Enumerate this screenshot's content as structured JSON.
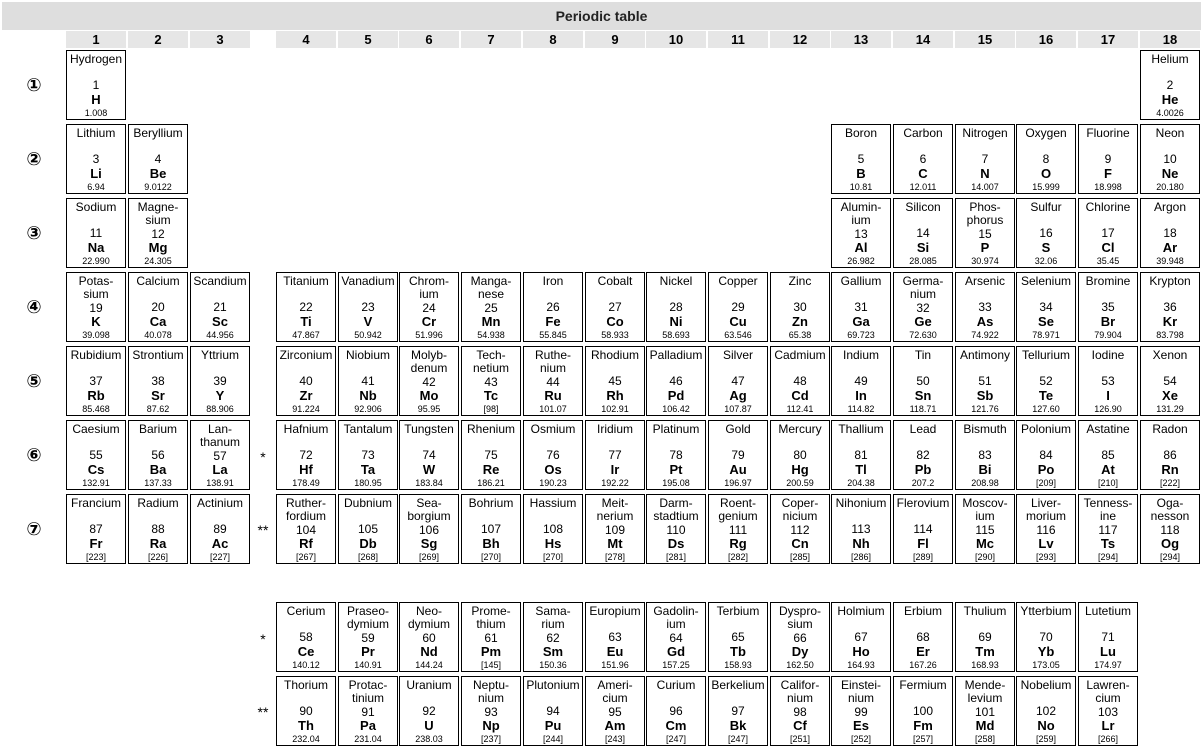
{
  "title": "Periodic table",
  "groups": [
    "1",
    "2",
    "3",
    "4",
    "5",
    "6",
    "7",
    "8",
    "9",
    "10",
    "11",
    "12",
    "13",
    "14",
    "15",
    "16",
    "17",
    "18"
  ],
  "periods": [
    "①",
    "②",
    "③",
    "④",
    "⑤",
    "⑥",
    "⑦"
  ],
  "markers": {
    "lanthanide": "*",
    "actinide": "**"
  },
  "elements": [
    {
      "name": "Hydrogen",
      "z": "1",
      "sym": "H",
      "mass": "1.008",
      "g": 1,
      "p": 1
    },
    {
      "name": "Helium",
      "z": "2",
      "sym": "He",
      "mass": "4.0026",
      "g": 18,
      "p": 1
    },
    {
      "name": "Lithium",
      "z": "3",
      "sym": "Li",
      "mass": "6.94",
      "g": 1,
      "p": 2
    },
    {
      "name": "Beryllium",
      "z": "4",
      "sym": "Be",
      "mass": "9.0122",
      "g": 2,
      "p": 2
    },
    {
      "name": "Boron",
      "z": "5",
      "sym": "B",
      "mass": "10.81",
      "g": 13,
      "p": 2
    },
    {
      "name": "Carbon",
      "z": "6",
      "sym": "C",
      "mass": "12.011",
      "g": 14,
      "p": 2
    },
    {
      "name": "Nitrogen",
      "z": "7",
      "sym": "N",
      "mass": "14.007",
      "g": 15,
      "p": 2
    },
    {
      "name": "Oxygen",
      "z": "8",
      "sym": "O",
      "mass": "15.999",
      "g": 16,
      "p": 2
    },
    {
      "name": "Fluorine",
      "z": "9",
      "sym": "F",
      "mass": "18.998",
      "g": 17,
      "p": 2
    },
    {
      "name": "Neon",
      "z": "10",
      "sym": "Ne",
      "mass": "20.180",
      "g": 18,
      "p": 2
    },
    {
      "name": "Sodium",
      "z": "11",
      "sym": "Na",
      "mass": "22.990",
      "g": 1,
      "p": 3
    },
    {
      "name": "Magne-\nsium",
      "z": "12",
      "sym": "Mg",
      "mass": "24.305",
      "g": 2,
      "p": 3
    },
    {
      "name": "Alumin-\nium",
      "z": "13",
      "sym": "Al",
      "mass": "26.982",
      "g": 13,
      "p": 3
    },
    {
      "name": "Silicon",
      "z": "14",
      "sym": "Si",
      "mass": "28.085",
      "g": 14,
      "p": 3
    },
    {
      "name": "Phos-\nphorus",
      "z": "15",
      "sym": "P",
      "mass": "30.974",
      "g": 15,
      "p": 3
    },
    {
      "name": "Sulfur",
      "z": "16",
      "sym": "S",
      "mass": "32.06",
      "g": 16,
      "p": 3
    },
    {
      "name": "Chlorine",
      "z": "17",
      "sym": "Cl",
      "mass": "35.45",
      "g": 17,
      "p": 3
    },
    {
      "name": "Argon",
      "z": "18",
      "sym": "Ar",
      "mass": "39.948",
      "g": 18,
      "p": 3
    },
    {
      "name": "Potas-\nsium",
      "z": "19",
      "sym": "K",
      "mass": "39.098",
      "g": 1,
      "p": 4
    },
    {
      "name": "Calcium",
      "z": "20",
      "sym": "Ca",
      "mass": "40.078",
      "g": 2,
      "p": 4
    },
    {
      "name": "Scandium",
      "z": "21",
      "sym": "Sc",
      "mass": "44.956",
      "g": 3,
      "p": 4
    },
    {
      "name": "Titanium",
      "z": "22",
      "sym": "Ti",
      "mass": "47.867",
      "g": 4,
      "p": 4
    },
    {
      "name": "Vanadium",
      "z": "23",
      "sym": "V",
      "mass": "50.942",
      "g": 5,
      "p": 4
    },
    {
      "name": "Chrom-\nium",
      "z": "24",
      "sym": "Cr",
      "mass": "51.996",
      "g": 6,
      "p": 4
    },
    {
      "name": "Manga-\nnese",
      "z": "25",
      "sym": "Mn",
      "mass": "54.938",
      "g": 7,
      "p": 4
    },
    {
      "name": "Iron",
      "z": "26",
      "sym": "Fe",
      "mass": "55.845",
      "g": 8,
      "p": 4
    },
    {
      "name": "Cobalt",
      "z": "27",
      "sym": "Co",
      "mass": "58.933",
      "g": 9,
      "p": 4
    },
    {
      "name": "Nickel",
      "z": "28",
      "sym": "Ni",
      "mass": "58.693",
      "g": 10,
      "p": 4
    },
    {
      "name": "Copper",
      "z": "29",
      "sym": "Cu",
      "mass": "63.546",
      "g": 11,
      "p": 4
    },
    {
      "name": "Zinc",
      "z": "30",
      "sym": "Zn",
      "mass": "65.38",
      "g": 12,
      "p": 4
    },
    {
      "name": "Gallium",
      "z": "31",
      "sym": "Ga",
      "mass": "69.723",
      "g": 13,
      "p": 4
    },
    {
      "name": "Germa-\nnium",
      "z": "32",
      "sym": "Ge",
      "mass": "72.630",
      "g": 14,
      "p": 4
    },
    {
      "name": "Arsenic",
      "z": "33",
      "sym": "As",
      "mass": "74.922",
      "g": 15,
      "p": 4
    },
    {
      "name": "Selenium",
      "z": "34",
      "sym": "Se",
      "mass": "78.971",
      "g": 16,
      "p": 4
    },
    {
      "name": "Bromine",
      "z": "35",
      "sym": "Br",
      "mass": "79.904",
      "g": 17,
      "p": 4
    },
    {
      "name": "Krypton",
      "z": "36",
      "sym": "Kr",
      "mass": "83.798",
      "g": 18,
      "p": 4
    },
    {
      "name": "Rubidium",
      "z": "37",
      "sym": "Rb",
      "mass": "85.468",
      "g": 1,
      "p": 5
    },
    {
      "name": "Strontium",
      "z": "38",
      "sym": "Sr",
      "mass": "87.62",
      "g": 2,
      "p": 5
    },
    {
      "name": "Yttrium",
      "z": "39",
      "sym": "Y",
      "mass": "88.906",
      "g": 3,
      "p": 5
    },
    {
      "name": "Zirconium",
      "z": "40",
      "sym": "Zr",
      "mass": "91.224",
      "g": 4,
      "p": 5
    },
    {
      "name": "Niobium",
      "z": "41",
      "sym": "Nb",
      "mass": "92.906",
      "g": 5,
      "p": 5
    },
    {
      "name": "Molyb-\ndenum",
      "z": "42",
      "sym": "Mo",
      "mass": "95.95",
      "g": 6,
      "p": 5
    },
    {
      "name": "Tech-\nnetium",
      "z": "43",
      "sym": "Tc",
      "mass": "[98]",
      "g": 7,
      "p": 5
    },
    {
      "name": "Ruthe-\nnium",
      "z": "44",
      "sym": "Ru",
      "mass": "101.07",
      "g": 8,
      "p": 5
    },
    {
      "name": "Rhodium",
      "z": "45",
      "sym": "Rh",
      "mass": "102.91",
      "g": 9,
      "p": 5
    },
    {
      "name": "Palladium",
      "z": "46",
      "sym": "Pd",
      "mass": "106.42",
      "g": 10,
      "p": 5
    },
    {
      "name": "Silver",
      "z": "47",
      "sym": "Ag",
      "mass": "107.87",
      "g": 11,
      "p": 5
    },
    {
      "name": "Cadmium",
      "z": "48",
      "sym": "Cd",
      "mass": "112.41",
      "g": 12,
      "p": 5
    },
    {
      "name": "Indium",
      "z": "49",
      "sym": "In",
      "mass": "114.82",
      "g": 13,
      "p": 5
    },
    {
      "name": "Tin",
      "z": "50",
      "sym": "Sn",
      "mass": "118.71",
      "g": 14,
      "p": 5
    },
    {
      "name": "Antimony",
      "z": "51",
      "sym": "Sb",
      "mass": "121.76",
      "g": 15,
      "p": 5
    },
    {
      "name": "Tellurium",
      "z": "52",
      "sym": "Te",
      "mass": "127.60",
      "g": 16,
      "p": 5
    },
    {
      "name": "Iodine",
      "z": "53",
      "sym": "I",
      "mass": "126.90",
      "g": 17,
      "p": 5
    },
    {
      "name": "Xenon",
      "z": "54",
      "sym": "Xe",
      "mass": "131.29",
      "g": 18,
      "p": 5
    },
    {
      "name": "Caesium",
      "z": "55",
      "sym": "Cs",
      "mass": "132.91",
      "g": 1,
      "p": 6
    },
    {
      "name": "Barium",
      "z": "56",
      "sym": "Ba",
      "mass": "137.33",
      "g": 2,
      "p": 6
    },
    {
      "name": "Lan-\nthanum",
      "z": "57",
      "sym": "La",
      "mass": "138.91",
      "g": 3,
      "p": 6
    },
    {
      "name": "Hafnium",
      "z": "72",
      "sym": "Hf",
      "mass": "178.49",
      "g": 4,
      "p": 6
    },
    {
      "name": "Tantalum",
      "z": "73",
      "sym": "Ta",
      "mass": "180.95",
      "g": 5,
      "p": 6
    },
    {
      "name": "Tungsten",
      "z": "74",
      "sym": "W",
      "mass": "183.84",
      "g": 6,
      "p": 6
    },
    {
      "name": "Rhenium",
      "z": "75",
      "sym": "Re",
      "mass": "186.21",
      "g": 7,
      "p": 6
    },
    {
      "name": "Osmium",
      "z": "76",
      "sym": "Os",
      "mass": "190.23",
      "g": 8,
      "p": 6
    },
    {
      "name": "Iridium",
      "z": "77",
      "sym": "Ir",
      "mass": "192.22",
      "g": 9,
      "p": 6
    },
    {
      "name": "Platinum",
      "z": "78",
      "sym": "Pt",
      "mass": "195.08",
      "g": 10,
      "p": 6
    },
    {
      "name": "Gold",
      "z": "79",
      "sym": "Au",
      "mass": "196.97",
      "g": 11,
      "p": 6
    },
    {
      "name": "Mercury",
      "z": "80",
      "sym": "Hg",
      "mass": "200.59",
      "g": 12,
      "p": 6
    },
    {
      "name": "Thallium",
      "z": "81",
      "sym": "Tl",
      "mass": "204.38",
      "g": 13,
      "p": 6
    },
    {
      "name": "Lead",
      "z": "82",
      "sym": "Pb",
      "mass": "207.2",
      "g": 14,
      "p": 6
    },
    {
      "name": "Bismuth",
      "z": "83",
      "sym": "Bi",
      "mass": "208.98",
      "g": 15,
      "p": 6
    },
    {
      "name": "Polonium",
      "z": "84",
      "sym": "Po",
      "mass": "[209]",
      "g": 16,
      "p": 6
    },
    {
      "name": "Astatine",
      "z": "85",
      "sym": "At",
      "mass": "[210]",
      "g": 17,
      "p": 6
    },
    {
      "name": "Radon",
      "z": "86",
      "sym": "Rn",
      "mass": "[222]",
      "g": 18,
      "p": 6
    },
    {
      "name": "Francium",
      "z": "87",
      "sym": "Fr",
      "mass": "[223]",
      "g": 1,
      "p": 7
    },
    {
      "name": "Radium",
      "z": "88",
      "sym": "Ra",
      "mass": "[226]",
      "g": 2,
      "p": 7
    },
    {
      "name": "Actinium",
      "z": "89",
      "sym": "Ac",
      "mass": "[227]",
      "g": 3,
      "p": 7
    },
    {
      "name": "Ruther-\nfordium",
      "z": "104",
      "sym": "Rf",
      "mass": "[267]",
      "g": 4,
      "p": 7
    },
    {
      "name": "Dubnium",
      "z": "105",
      "sym": "Db",
      "mass": "[268]",
      "g": 5,
      "p": 7
    },
    {
      "name": "Sea-\nborgium",
      "z": "106",
      "sym": "Sg",
      "mass": "[269]",
      "g": 6,
      "p": 7
    },
    {
      "name": "Bohrium",
      "z": "107",
      "sym": "Bh",
      "mass": "[270]",
      "g": 7,
      "p": 7
    },
    {
      "name": "Hassium",
      "z": "108",
      "sym": "Hs",
      "mass": "[270]",
      "g": 8,
      "p": 7
    },
    {
      "name": "Meit-\nnerium",
      "z": "109",
      "sym": "Mt",
      "mass": "[278]",
      "g": 9,
      "p": 7
    },
    {
      "name": "Darm-\nstadtium",
      "z": "110",
      "sym": "Ds",
      "mass": "[281]",
      "g": 10,
      "p": 7
    },
    {
      "name": "Roent-\ngenium",
      "z": "111",
      "sym": "Rg",
      "mass": "[282]",
      "g": 11,
      "p": 7
    },
    {
      "name": "Coper-\nnicium",
      "z": "112",
      "sym": "Cn",
      "mass": "[285]",
      "g": 12,
      "p": 7
    },
    {
      "name": "Nihonium",
      "z": "113",
      "sym": "Nh",
      "mass": "[286]",
      "g": 13,
      "p": 7
    },
    {
      "name": "Flerovium",
      "z": "114",
      "sym": "Fl",
      "mass": "[289]",
      "g": 14,
      "p": 7
    },
    {
      "name": "Moscov-\nium",
      "z": "115",
      "sym": "Mc",
      "mass": "[290]",
      "g": 15,
      "p": 7
    },
    {
      "name": "Liver-\nmorium",
      "z": "116",
      "sym": "Lv",
      "mass": "[293]",
      "g": 16,
      "p": 7
    },
    {
      "name": "Tenness-\nine",
      "z": "117",
      "sym": "Ts",
      "mass": "[294]",
      "g": 17,
      "p": 7
    },
    {
      "name": "Oga-\nnesson",
      "z": "118",
      "sym": "Og",
      "mass": "[294]",
      "g": 18,
      "p": 7
    },
    {
      "name": "Cerium",
      "z": "58",
      "sym": "Ce",
      "mass": "140.12",
      "g": 4,
      "p": "la"
    },
    {
      "name": "Praseo-\ndymium",
      "z": "59",
      "sym": "Pr",
      "mass": "140.91",
      "g": 5,
      "p": "la"
    },
    {
      "name": "Neo-\ndymium",
      "z": "60",
      "sym": "Nd",
      "mass": "144.24",
      "g": 6,
      "p": "la"
    },
    {
      "name": "Prome-\nthium",
      "z": "61",
      "sym": "Pm",
      "mass": "[145]",
      "g": 7,
      "p": "la"
    },
    {
      "name": "Sama-\nrium",
      "z": "62",
      "sym": "Sm",
      "mass": "150.36",
      "g": 8,
      "p": "la"
    },
    {
      "name": "Europium",
      "z": "63",
      "sym": "Eu",
      "mass": "151.96",
      "g": 9,
      "p": "la"
    },
    {
      "name": "Gadolin-\nium",
      "z": "64",
      "sym": "Gd",
      "mass": "157.25",
      "g": 10,
      "p": "la"
    },
    {
      "name": "Terbium",
      "z": "65",
      "sym": "Tb",
      "mass": "158.93",
      "g": 11,
      "p": "la"
    },
    {
      "name": "Dyspro-\nsium",
      "z": "66",
      "sym": "Dy",
      "mass": "162.50",
      "g": 12,
      "p": "la"
    },
    {
      "name": "Holmium",
      "z": "67",
      "sym": "Ho",
      "mass": "164.93",
      "g": 13,
      "p": "la"
    },
    {
      "name": "Erbium",
      "z": "68",
      "sym": "Er",
      "mass": "167.26",
      "g": 14,
      "p": "la"
    },
    {
      "name": "Thulium",
      "z": "69",
      "sym": "Tm",
      "mass": "168.93",
      "g": 15,
      "p": "la"
    },
    {
      "name": "Ytterbium",
      "z": "70",
      "sym": "Yb",
      "mass": "173.05",
      "g": 16,
      "p": "la"
    },
    {
      "name": "Lutetium",
      "z": "71",
      "sym": "Lu",
      "mass": "174.97",
      "g": 17,
      "p": "la"
    },
    {
      "name": "Thorium",
      "z": "90",
      "sym": "Th",
      "mass": "232.04",
      "g": 4,
      "p": "ac"
    },
    {
      "name": "Protac-\ntinium",
      "z": "91",
      "sym": "Pa",
      "mass": "231.04",
      "g": 5,
      "p": "ac"
    },
    {
      "name": "Uranium",
      "z": "92",
      "sym": "U",
      "mass": "238.03",
      "g": 6,
      "p": "ac"
    },
    {
      "name": "Neptu-\nnium",
      "z": "93",
      "sym": "Np",
      "mass": "[237]",
      "g": 7,
      "p": "ac"
    },
    {
      "name": "Plutonium",
      "z": "94",
      "sym": "Pu",
      "mass": "[244]",
      "g": 8,
      "p": "ac"
    },
    {
      "name": "Ameri-\ncium",
      "z": "95",
      "sym": "Am",
      "mass": "[243]",
      "g": 9,
      "p": "ac"
    },
    {
      "name": "Curium",
      "z": "96",
      "sym": "Cm",
      "mass": "[247]",
      "g": 10,
      "p": "ac"
    },
    {
      "name": "Berkelium",
      "z": "97",
      "sym": "Bk",
      "mass": "[247]",
      "g": 11,
      "p": "ac"
    },
    {
      "name": "Califor-\nnium",
      "z": "98",
      "sym": "Cf",
      "mass": "[251]",
      "g": 12,
      "p": "ac"
    },
    {
      "name": "Einstei-\nnium",
      "z": "99",
      "sym": "Es",
      "mass": "[252]",
      "g": 13,
      "p": "ac"
    },
    {
      "name": "Fermium",
      "z": "100",
      "sym": "Fm",
      "mass": "[257]",
      "g": 14,
      "p": "ac"
    },
    {
      "name": "Mende-\nlevium",
      "z": "101",
      "sym": "Md",
      "mass": "[258]",
      "g": 15,
      "p": "ac"
    },
    {
      "name": "Nobelium",
      "z": "102",
      "sym": "No",
      "mass": "[259]",
      "g": 16,
      "p": "ac"
    },
    {
      "name": "Lawren-\ncium",
      "z": "103",
      "sym": "Lr",
      "mass": "[266]",
      "g": 17,
      "p": "ac"
    }
  ]
}
